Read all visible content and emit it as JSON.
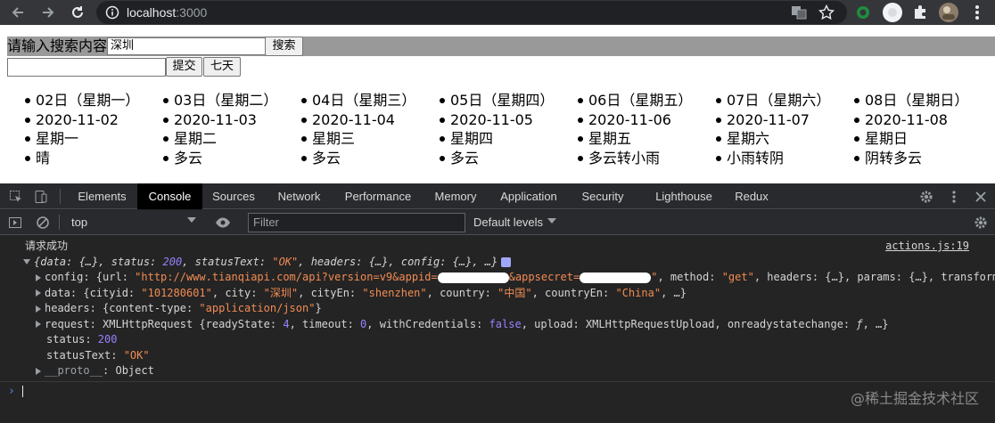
{
  "browser": {
    "url_host": "localhost",
    "url_port": ":3000"
  },
  "page": {
    "search_label": "请输入搜索内容",
    "search_value": "深圳",
    "search_button": "搜索",
    "submit_value": "",
    "submit_button": "提交",
    "seven_days_button": "七天",
    "days": [
      {
        "day": "02日（星期一）",
        "date": "2020-11-02",
        "week": "星期一",
        "wea": "晴"
      },
      {
        "day": "03日（星期二）",
        "date": "2020-11-03",
        "week": "星期二",
        "wea": "多云"
      },
      {
        "day": "04日（星期三）",
        "date": "2020-11-04",
        "week": "星期三",
        "wea": "多云"
      },
      {
        "day": "05日（星期四）",
        "date": "2020-11-05",
        "week": "星期四",
        "wea": "多云"
      },
      {
        "day": "06日（星期五）",
        "date": "2020-11-06",
        "week": "星期五",
        "wea": "多云转小雨"
      },
      {
        "day": "07日（星期六）",
        "date": "2020-11-07",
        "week": "星期六",
        "wea": "小雨转阴"
      },
      {
        "day": "08日（星期日）",
        "date": "2020-11-08",
        "week": "星期日",
        "wea": "阴转多云"
      }
    ]
  },
  "devtools": {
    "tabs": [
      "Elements",
      "Console",
      "Sources",
      "Network",
      "Performance",
      "Memory",
      "Application",
      "Security",
      "Lighthouse",
      "Redux"
    ],
    "active_tab": "Console",
    "context": "top",
    "filter_placeholder": "Filter",
    "levels": "Default levels"
  },
  "console": {
    "log_message": "请求成功",
    "source_link": "actions.js:19",
    "summary": {
      "open": "{data: {…}, status: ",
      "status": "200",
      "mid": ", statusText: ",
      "statusText": "\"OK\"",
      "tail": ", headers: {…}, config: {…}, …}"
    },
    "config": {
      "key": "config: ",
      "pre": "{url: ",
      "url_a": "\"http://www.tianqiapi.com/api?version=v9&appid=",
      "url_b": "&appsecret=",
      "url_c": "\"",
      "rest": ", method: ",
      "method": "\"get\"",
      "rest2": ", headers: {…}, params: {…}, transform…"
    },
    "data": {
      "key": "data: ",
      "p1": "{cityid: ",
      "cityid": "\"101280601\"",
      "p2": ", city: ",
      "city": "\"深圳\"",
      "p3": ", cityEn: ",
      "cityEn": "\"shenzhen\"",
      "p4": ", country: ",
      "country": "\"中国\"",
      "p5": ", countryEn: ",
      "countryEn": "\"China\"",
      "p6": ", …}"
    },
    "headers": {
      "key": "headers: ",
      "p1": "{content-type: ",
      "ct": "\"application/json\"",
      "p2": "}"
    },
    "request": {
      "key": "request: ",
      "p1": "XMLHttpRequest {readyState: ",
      "rs": "4",
      "p2": ", timeout: ",
      "to": "0",
      "p3": ", withCredentials: ",
      "wc": "false",
      "p4": ", upload: XMLHttpRequestUpload, onreadystatechange: ",
      "fn": "ƒ",
      "p5": ", …}"
    },
    "status": {
      "key": "status: ",
      "val": "200"
    },
    "statusText": {
      "key": "statusText: ",
      "val": "\"OK\""
    },
    "proto": {
      "key": "__proto__",
      "val": ": Object"
    }
  },
  "watermark": "@稀土掘金技术社区"
}
